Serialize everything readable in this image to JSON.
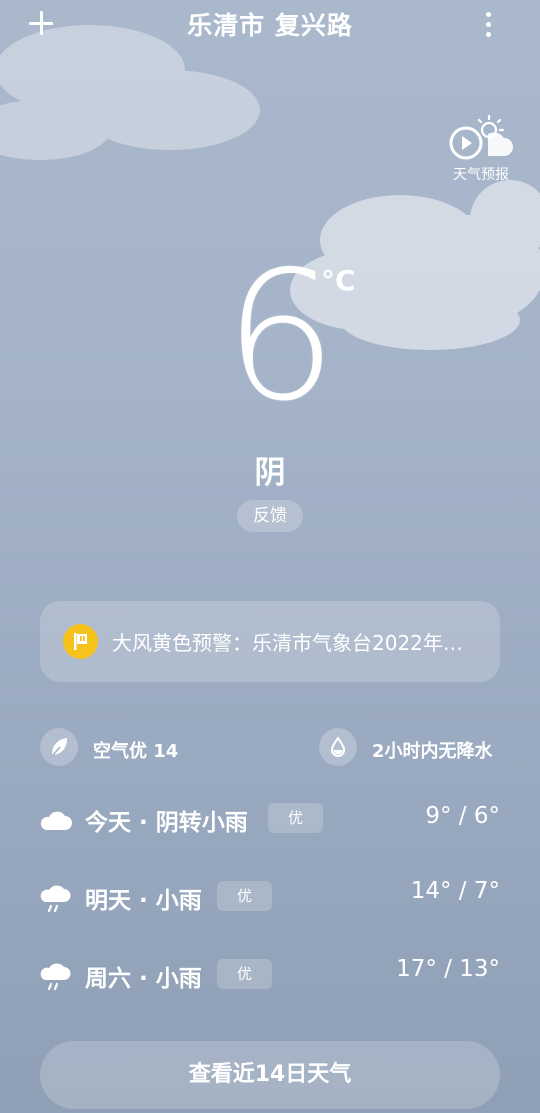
{
  "header": {
    "location": "乐清市 复兴路",
    "video_label": "天气预报"
  },
  "current": {
    "temperature": "6",
    "unit": "°C",
    "condition": "阴",
    "feedback_label": "反馈"
  },
  "alert": {
    "text": "大风黄色预警：乐清市气象台2022年…",
    "color": "#f6c21c"
  },
  "indicators": {
    "air_quality": "空气优 14",
    "precipitation": "2小时内无降水"
  },
  "forecast": [
    {
      "label": "今天 · 阴转小雨",
      "aq": "优",
      "temps": "9° / 6°",
      "icon": "cloud-icon"
    },
    {
      "label": "明天 · 小雨",
      "aq": "优",
      "temps": "14° / 7°",
      "icon": "light-rain-icon"
    },
    {
      "label": "周六 · 小雨",
      "aq": "优",
      "temps": "17° / 13°",
      "icon": "light-rain-icon"
    }
  ],
  "bottom_button": "查看近14日天气"
}
